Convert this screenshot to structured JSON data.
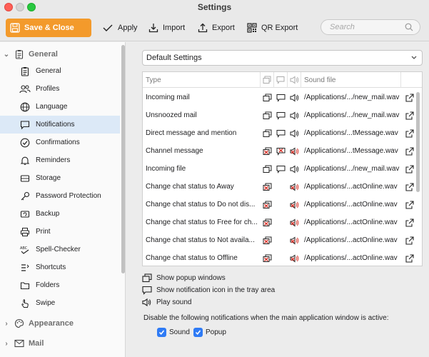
{
  "window": {
    "title": "Settings"
  },
  "toolbar": {
    "save_close": "Save & Close",
    "apply": "Apply",
    "import": "Import",
    "export": "Export",
    "qr_export": "QR Export",
    "search_placeholder": "Search"
  },
  "sidebar": {
    "groups": [
      {
        "label": "General",
        "icon": "clipboard-icon",
        "expanded": true
      },
      {
        "label": "Appearance",
        "icon": "palette-icon",
        "expanded": false
      },
      {
        "label": "Mail",
        "icon": "envelope-icon",
        "expanded": false
      }
    ],
    "items": [
      {
        "label": "General",
        "icon": "clipboard-icon"
      },
      {
        "label": "Profiles",
        "icon": "users-icon"
      },
      {
        "label": "Language",
        "icon": "globe-icon"
      },
      {
        "label": "Notifications",
        "icon": "chat-bubble-icon",
        "active": true
      },
      {
        "label": "Confirmations",
        "icon": "check-circle-icon"
      },
      {
        "label": "Reminders",
        "icon": "bell-icon"
      },
      {
        "label": "Storage",
        "icon": "database-icon"
      },
      {
        "label": "Password Protection",
        "icon": "key-icon"
      },
      {
        "label": "Backup",
        "icon": "backup-icon"
      },
      {
        "label": "Print",
        "icon": "printer-icon"
      },
      {
        "label": "Spell-Checker",
        "icon": "spellcheck-icon"
      },
      {
        "label": "Shortcuts",
        "icon": "shortcuts-icon"
      },
      {
        "label": "Folders",
        "icon": "folder-icon"
      },
      {
        "label": "Swipe",
        "icon": "swipe-hand-icon"
      }
    ]
  },
  "main": {
    "profile_select": "Default Settings",
    "table": {
      "headers": {
        "type": "Type",
        "sound_file": "Sound file"
      },
      "rows": [
        {
          "type": "Incoming mail",
          "popup": true,
          "tray": true,
          "sound": true,
          "file": "/Applications/.../new_mail.wav"
        },
        {
          "type": "Unsnoozed mail",
          "popup": true,
          "tray": true,
          "sound": true,
          "file": "/Applications/.../new_mail.wav"
        },
        {
          "type": "Direct message and mention",
          "popup": true,
          "tray": true,
          "sound": true,
          "file": "/Applications/...tMessage.wav"
        },
        {
          "type": "Channel message",
          "popup": false,
          "tray": false,
          "sound": false,
          "file": "/Applications/...tMessage.wav"
        },
        {
          "type": "Incoming file",
          "popup": true,
          "tray": true,
          "sound": true,
          "file": "/Applications/.../new_mail.wav"
        },
        {
          "type": "Change chat status to Away",
          "popup": false,
          "tray": null,
          "sound": false,
          "file": "/Applications/...actOnline.wav"
        },
        {
          "type": "Change chat status to Do not dis...",
          "popup": false,
          "tray": null,
          "sound": false,
          "file": "/Applications/...actOnline.wav"
        },
        {
          "type": "Change chat status to Free for ch...",
          "popup": false,
          "tray": null,
          "sound": false,
          "file": "/Applications/...actOnline.wav"
        },
        {
          "type": "Change chat status to Not availa...",
          "popup": false,
          "tray": null,
          "sound": false,
          "file": "/Applications/...actOnline.wav"
        },
        {
          "type": "Change chat status to Offline",
          "popup": false,
          "tray": null,
          "sound": false,
          "file": "/Applications/...actOnline.wav"
        }
      ]
    },
    "legend": {
      "popup": "Show popup windows",
      "tray": "Show notification icon in the tray area",
      "sound": "Play sound"
    },
    "disable_label": "Disable the following notifications when the main application window is active:",
    "disable_sound": "Sound",
    "disable_popup": "Popup"
  },
  "colors": {
    "accent": "#f39a2b",
    "selected": "#dce9f7",
    "checkbox": "#2f7bf5",
    "disabled_red": "#d9342b"
  }
}
